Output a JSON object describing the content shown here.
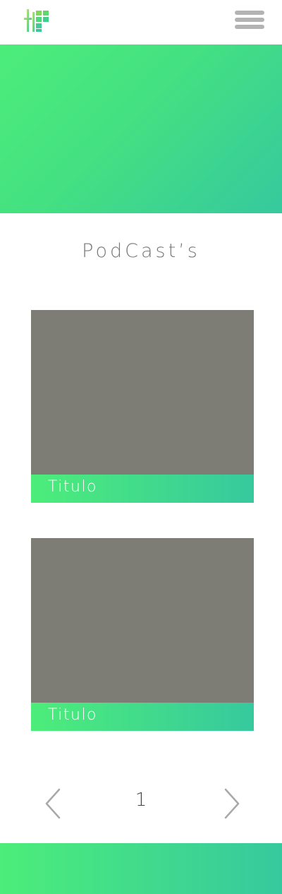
{
  "header": {
    "logo_icon": "logo-icon",
    "menu_icon": "hamburger-menu-icon"
  },
  "colors": {
    "accent_start": "#4ded7a",
    "accent_end": "#36c99e",
    "card_image": "#7d7d76"
  },
  "section": {
    "title": "PodCast’s"
  },
  "podcasts": [
    {
      "title": "Titulo"
    },
    {
      "title": "Titulo"
    }
  ],
  "pagination": {
    "current_page": "1",
    "prev_icon": "chevron-left-icon",
    "next_icon": "chevron-right-icon"
  }
}
